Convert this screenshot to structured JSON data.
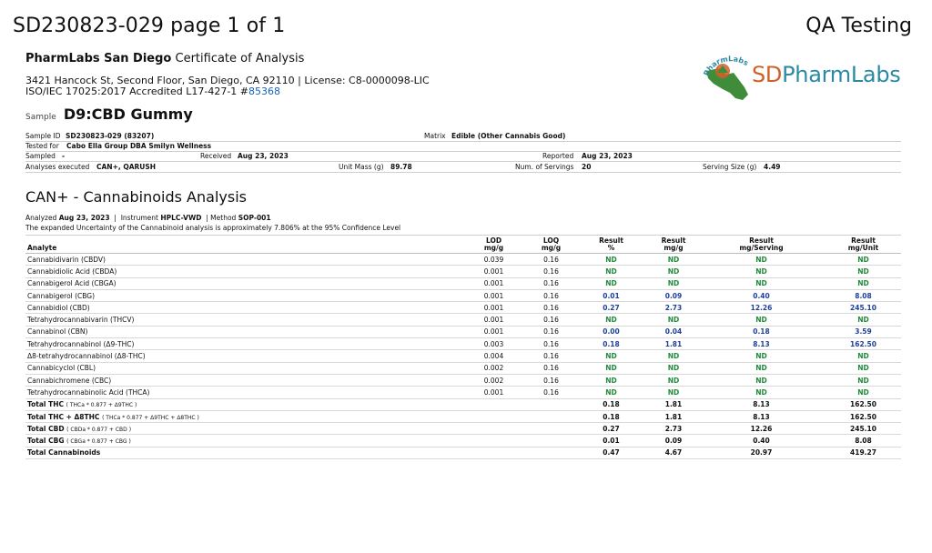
{
  "header": {
    "title": "SD230823-029 page 1 of 1",
    "right_title": "QA Testing"
  },
  "lab": {
    "name": "PharmLabs San Diego",
    "doc_type": "Certificate of Analysis",
    "address": "3421 Hancock St, Second Floor, San Diego, CA 92110 |  License: C8-0000098-LIC",
    "accreditation": "ISO/IEC 17025:2017 Accredited L17-427-1 #",
    "accreditation_number": "85368"
  },
  "logo": {
    "text_sd": "SD",
    "text_rest": "PharmLabs",
    "arc_text": "PharmLabs",
    "colors": {
      "orange": "#d35f28",
      "teal": "#2b8aa3",
      "green": "#3f8c3a"
    }
  },
  "sample": {
    "label": "Sample",
    "name": "D9:CBD Gummy"
  },
  "info": {
    "sample_id_label": "Sample ID",
    "sample_id": "SD230823-029 (83207)",
    "matrix_label": "Matrix",
    "matrix": "Edible (Other Cannabis Good)",
    "tested_for_label": "Tested for",
    "tested_for": "Cabo Ella Group DBA Smilyn Wellness",
    "sampled_label": "Sampled",
    "sampled": "-",
    "received_label": "Received",
    "received": "Aug 23, 2023",
    "reported_label": "Reported",
    "reported": "Aug 23, 2023",
    "analyses_label": "Analyses executed",
    "analyses": "CAN+, QARUSH",
    "unit_mass_label": "Unit Mass (g)",
    "unit_mass": "89.78",
    "servings_label": "Num. of Servings",
    "servings": "20",
    "serving_size_label": "Serving Size (g)",
    "serving_size": "4.49"
  },
  "analysis": {
    "title": "CAN+ - Cannabinoids Analysis",
    "analyzed_label": "Analyzed",
    "analyzed_date": "Aug 23, 2023",
    "instrument_label": "Instrument",
    "instrument": "HPLC-VWD",
    "method_label": "Method",
    "method": "SOP-001",
    "uncertainty": "The expanded Uncertainty of the Cannabinoid analysis is approximately 7.806% at the 95% Confidence Level"
  },
  "table": {
    "headers": {
      "analyte": "Analyte",
      "lod": [
        "LOD",
        "mg/g"
      ],
      "loq": [
        "LOQ",
        "mg/g"
      ],
      "pct": [
        "Result",
        "%"
      ],
      "mgg": [
        "Result",
        "mg/g"
      ],
      "serving": [
        "Result",
        "mg/Serving"
      ],
      "unit": [
        "Result",
        "mg/Unit"
      ]
    },
    "rows": [
      {
        "analyte": "Cannabidivarin (CBDV)",
        "lod": "0.039",
        "loq": "0.16",
        "pct": "ND",
        "mgg": "ND",
        "serving": "ND",
        "unit": "ND"
      },
      {
        "analyte": "Cannabidiolic Acid (CBDA)",
        "lod": "0.001",
        "loq": "0.16",
        "pct": "ND",
        "mgg": "ND",
        "serving": "ND",
        "unit": "ND"
      },
      {
        "analyte": "Cannabigerol Acid (CBGA)",
        "lod": "0.001",
        "loq": "0.16",
        "pct": "ND",
        "mgg": "ND",
        "serving": "ND",
        "unit": "ND"
      },
      {
        "analyte": "Cannabigerol (CBG)",
        "lod": "0.001",
        "loq": "0.16",
        "pct": "0.01",
        "mgg": "0.09",
        "serving": "0.40",
        "unit": "8.08"
      },
      {
        "analyte": "Cannabidiol (CBD)",
        "lod": "0.001",
        "loq": "0.16",
        "pct": "0.27",
        "mgg": "2.73",
        "serving": "12.26",
        "unit": "245.10"
      },
      {
        "analyte": "Tetrahydrocannabivarin (THCV)",
        "lod": "0.001",
        "loq": "0.16",
        "pct": "ND",
        "mgg": "ND",
        "serving": "ND",
        "unit": "ND"
      },
      {
        "analyte": "Cannabinol (CBN)",
        "lod": "0.001",
        "loq": "0.16",
        "pct": "0.00",
        "mgg": "0.04",
        "serving": "0.18",
        "unit": "3.59"
      },
      {
        "analyte": "Tetrahydrocannabinol (Δ9-THC)",
        "lod": "0.003",
        "loq": "0.16",
        "pct": "0.18",
        "mgg": "1.81",
        "serving": "8.13",
        "unit": "162.50"
      },
      {
        "analyte": "Δ8-tetrahydrocannabinol (Δ8-THC)",
        "lod": "0.004",
        "loq": "0.16",
        "pct": "ND",
        "mgg": "ND",
        "serving": "ND",
        "unit": "ND"
      },
      {
        "analyte": "Cannabicyclol (CBL)",
        "lod": "0.002",
        "loq": "0.16",
        "pct": "ND",
        "mgg": "ND",
        "serving": "ND",
        "unit": "ND"
      },
      {
        "analyte": "Cannabichromene (CBC)",
        "lod": "0.002",
        "loq": "0.16",
        "pct": "ND",
        "mgg": "ND",
        "serving": "ND",
        "unit": "ND"
      },
      {
        "analyte": "Tetrahydrocannabinolic Acid (THCA)",
        "lod": "0.001",
        "loq": "0.16",
        "pct": "ND",
        "mgg": "ND",
        "serving": "ND",
        "unit": "ND"
      }
    ],
    "totals": [
      {
        "analyte": "Total THC",
        "formula": "( THCa * 0.877 + Δ9THC )",
        "pct": "0.18",
        "mgg": "1.81",
        "serving": "8.13",
        "unit": "162.50"
      },
      {
        "analyte": "Total THC + Δ8THC",
        "formula": "( THCa * 0.877 + Δ9THC + Δ8THC )",
        "pct": "0.18",
        "mgg": "1.81",
        "serving": "8.13",
        "unit": "162.50"
      },
      {
        "analyte": "Total CBD",
        "formula": "( CBDa * 0.877 + CBD )",
        "pct": "0.27",
        "mgg": "2.73",
        "serving": "12.26",
        "unit": "245.10"
      },
      {
        "analyte": "Total CBG",
        "formula": "( CBGa * 0.877 + CBG )",
        "pct": "0.01",
        "mgg": "0.09",
        "serving": "0.40",
        "unit": "8.08"
      },
      {
        "analyte": "Total Cannabinoids",
        "formula": "",
        "pct": "0.47",
        "mgg": "4.67",
        "serving": "20.97",
        "unit": "419.27"
      }
    ]
  }
}
